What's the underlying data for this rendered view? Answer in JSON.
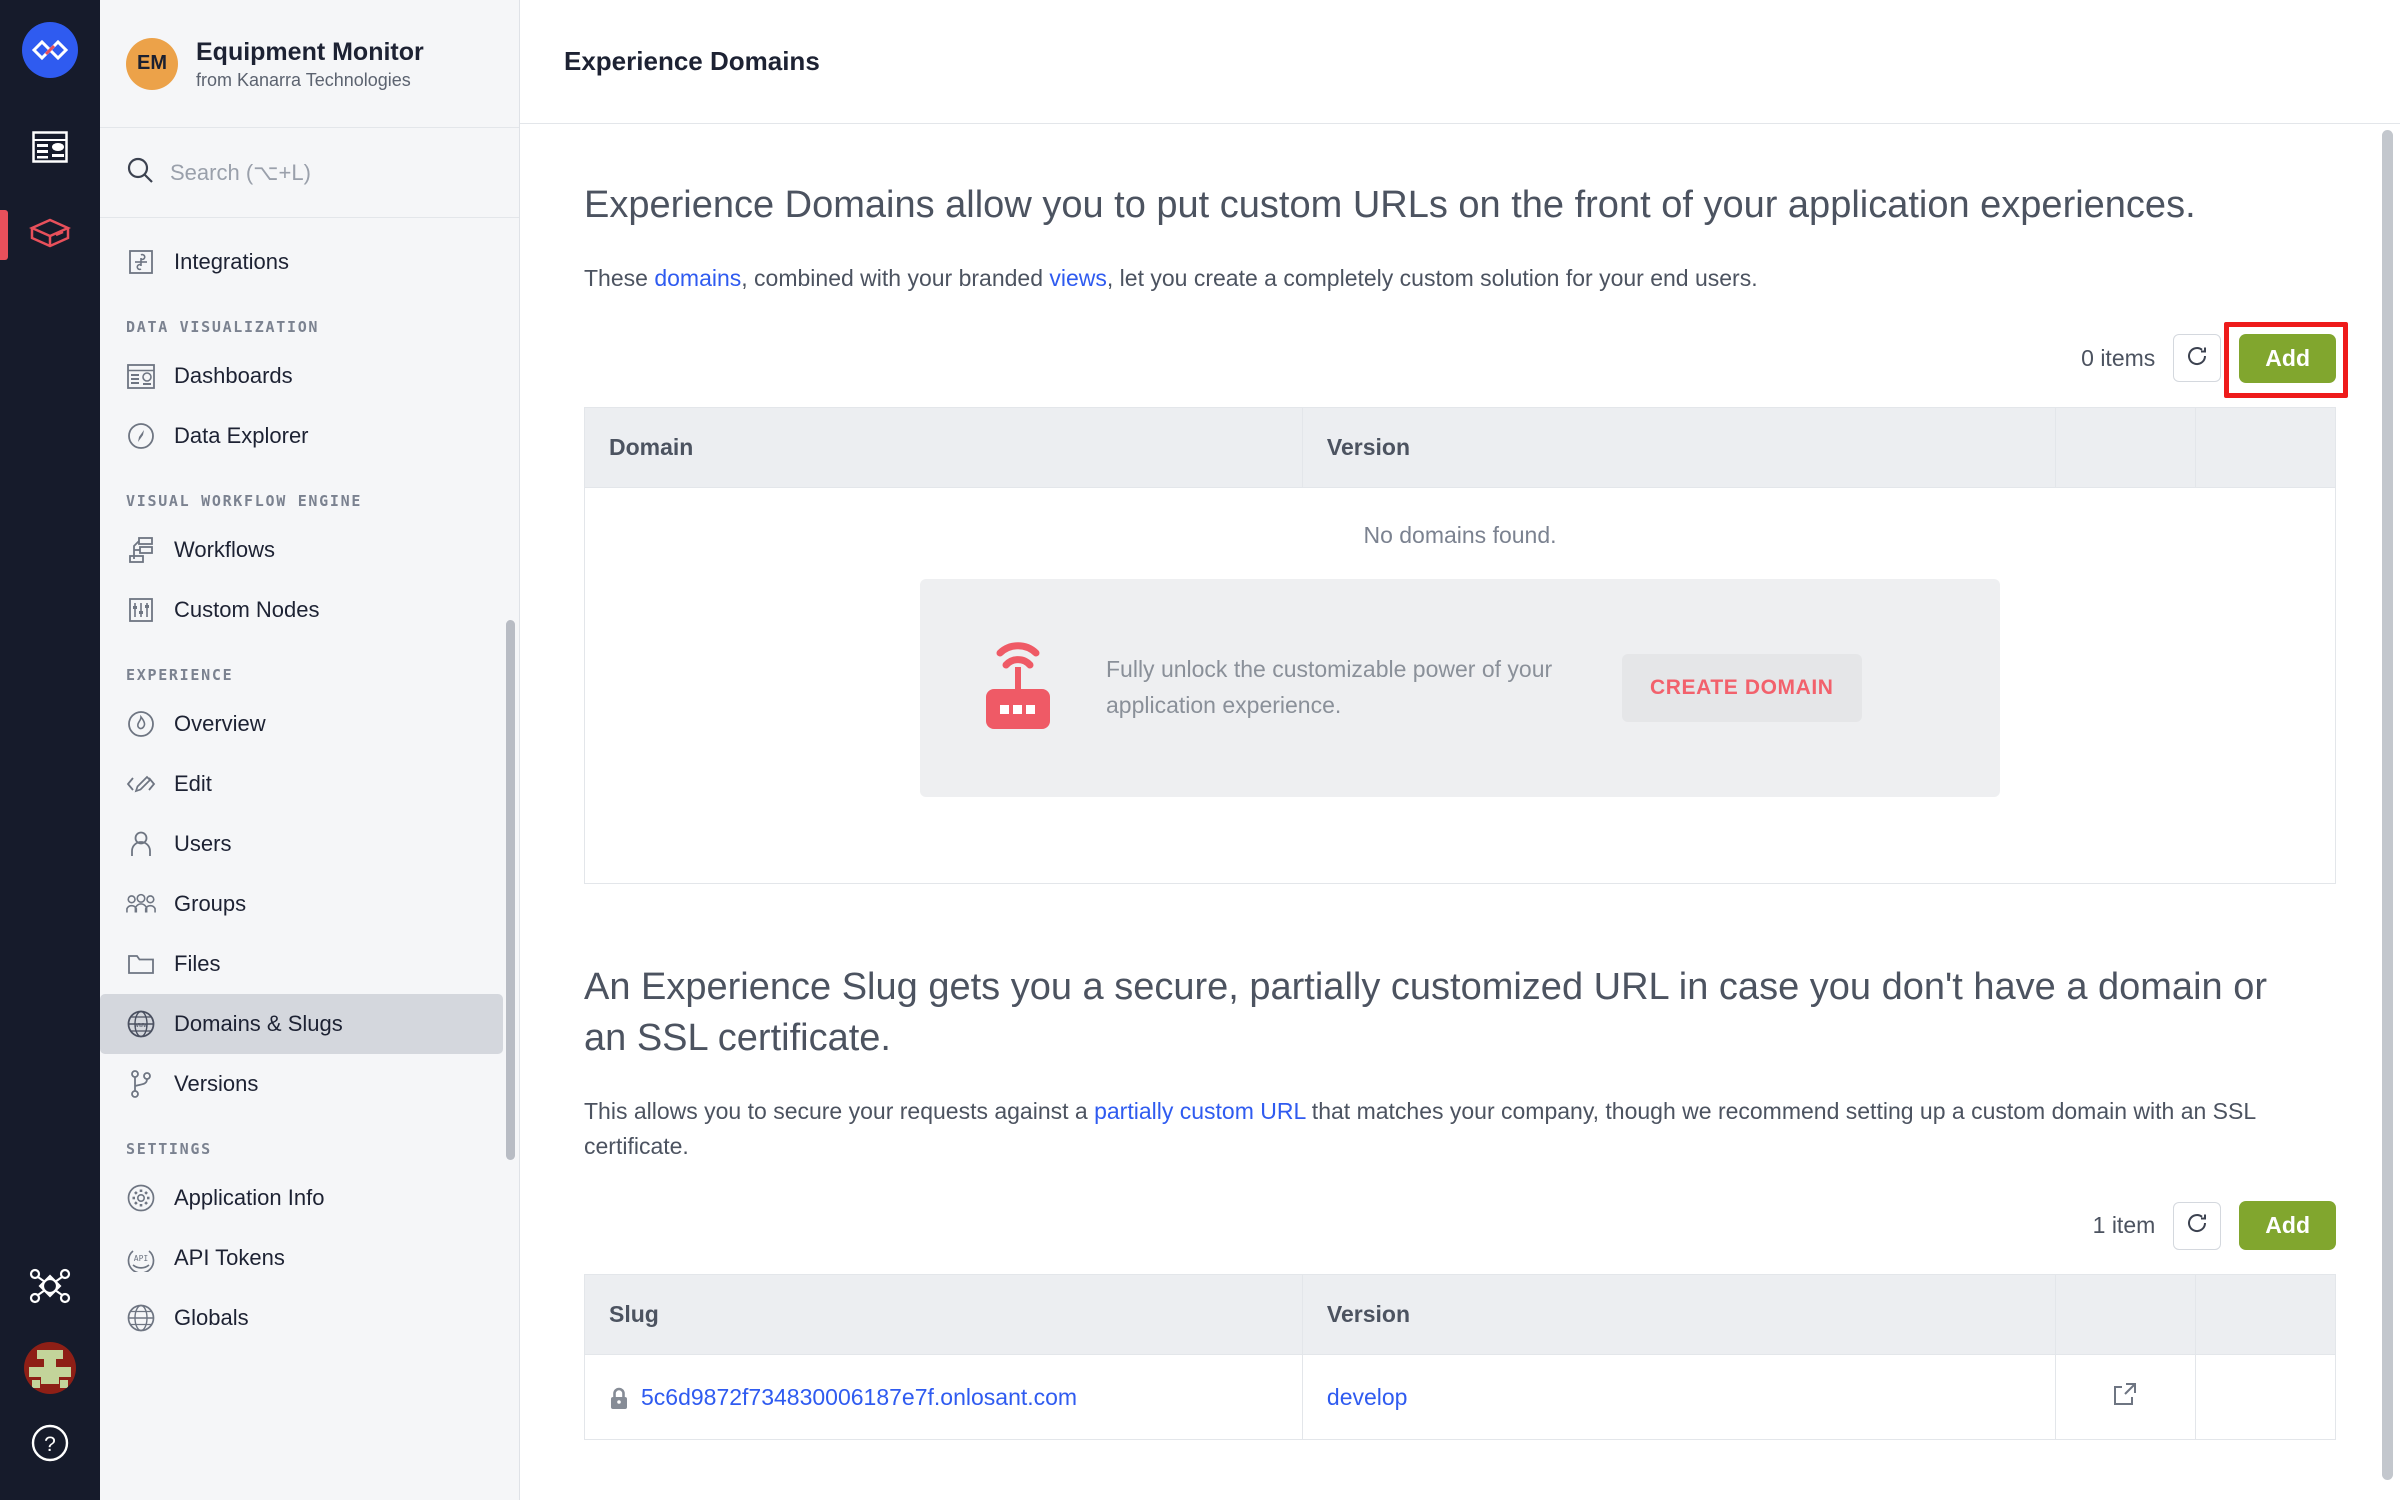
{
  "rail": {
    "logo": "losant-logo",
    "items": [
      {
        "icon": "dashboard-icon",
        "name": "dashboards"
      },
      {
        "icon": "package-icon",
        "name": "applications",
        "active": true
      }
    ],
    "bottom": [
      {
        "icon": "network-icon",
        "name": "organizations"
      },
      {
        "icon": "avatar",
        "name": "user-avatar"
      },
      {
        "icon": "help-icon",
        "name": "help"
      }
    ]
  },
  "sidebar": {
    "app_initials": "EM",
    "app_name": "Equipment Monitor",
    "app_org": "from Kanarra Technologies",
    "search_placeholder": "Search (⌥+L)",
    "top_items": [
      {
        "label": "Integrations",
        "icon": "puzzle-icon"
      }
    ],
    "groups": [
      {
        "label": "DATA VISUALIZATION",
        "items": [
          {
            "label": "Dashboards",
            "icon": "dashboard-icon"
          },
          {
            "label": "Data Explorer",
            "icon": "compass-icon"
          }
        ]
      },
      {
        "label": "VISUAL WORKFLOW ENGINE",
        "items": [
          {
            "label": "Workflows",
            "icon": "workflow-icon"
          },
          {
            "label": "Custom Nodes",
            "icon": "sliders-icon"
          }
        ]
      },
      {
        "label": "EXPERIENCE",
        "items": [
          {
            "label": "Overview",
            "icon": "drop-icon"
          },
          {
            "label": "Edit",
            "icon": "code-pencil-icon"
          },
          {
            "label": "Users",
            "icon": "user-icon"
          },
          {
            "label": "Groups",
            "icon": "group-icon"
          },
          {
            "label": "Files",
            "icon": "folder-icon"
          },
          {
            "label": "Domains & Slugs",
            "icon": "globe-www-icon",
            "active": true
          },
          {
            "label": "Versions",
            "icon": "branch-icon"
          }
        ]
      },
      {
        "label": "SETTINGS",
        "items": [
          {
            "label": "Application Info",
            "icon": "gear-icon"
          },
          {
            "label": "API Tokens",
            "icon": "api-icon"
          },
          {
            "label": "Globals",
            "icon": "globe-icon"
          }
        ]
      }
    ]
  },
  "header": {
    "title": "Experience Domains"
  },
  "domains_section": {
    "heading": "Experience Domains allow you to put custom URLs on the front of your application experiences.",
    "sub_prefix": "These ",
    "sub_link1": "domains",
    "sub_mid": ", combined with your branded ",
    "sub_link2": "views",
    "sub_suffix": ", let you create a completely custom solution for your end users.",
    "count": "0 items",
    "refresh_icon": "refresh-icon",
    "add_label": "Add",
    "columns": [
      "Domain",
      "Version"
    ],
    "empty_message": "No domains found.",
    "promo": {
      "icon": "router-icon",
      "text": "Fully unlock the customizable power of your application experience.",
      "button": "CREATE DOMAIN"
    }
  },
  "slugs_section": {
    "heading": "An Experience Slug gets you a secure, partially customized URL in case you don't have a domain or an SSL certificate.",
    "sub_prefix": "This allows you to secure your requests against a ",
    "sub_link": "partially custom URL",
    "sub_suffix": " that matches your company, though we recommend setting up a custom domain with an SSL certificate.",
    "count": "1 item",
    "refresh_icon": "refresh-icon",
    "add_label": "Add",
    "columns": [
      "Slug",
      "Version"
    ],
    "rows": [
      {
        "lock_icon": "lock-icon",
        "slug": "5c6d9872f734830006187e7f.onlosant.com",
        "version": "develop",
        "action_icon": "external-link-icon"
      }
    ]
  },
  "colors": {
    "accent_blue": "#2f5bf0",
    "add_green": "#81a62e",
    "highlight_red": "#ee1b1b",
    "promo_red": "#f2616c",
    "rail_bg": "#161b2b",
    "sidebar_bg": "#f5f6f8",
    "avatar_orange": "#eca249"
  }
}
